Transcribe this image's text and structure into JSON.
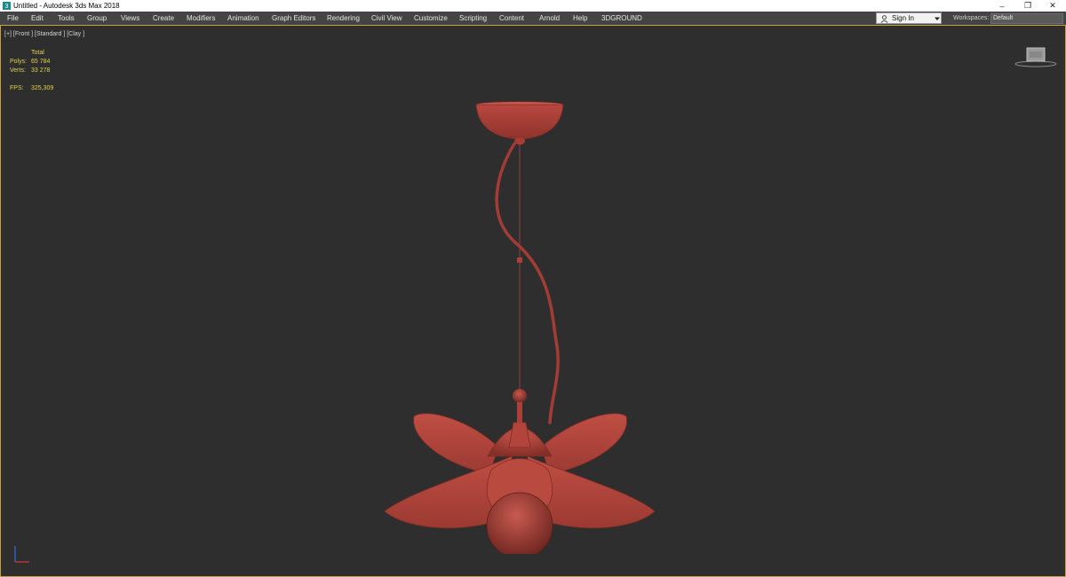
{
  "window": {
    "title": "Untitled - Autodesk 3ds Max 2018",
    "controls": {
      "minimize": "–",
      "restore": "❐",
      "close": "✕"
    }
  },
  "menubar": {
    "items": [
      "File",
      "Edit",
      "Tools",
      "Group",
      "Views",
      "Create",
      "Modifiers",
      "Animation",
      "Graph Editors",
      "Rendering",
      "Civil View",
      "Customize",
      "Scripting",
      "Content",
      "Arnold",
      "Help",
      "3DGROUND"
    ],
    "sign_in": "Sign In",
    "workspaces_label": "Workspaces:",
    "workspace_value": "Default"
  },
  "viewport": {
    "label": "[+] [Front ] [Standard ] [Clay ]",
    "stats": {
      "header": "Total",
      "polys_label": "Polys:",
      "polys_value": "65 784",
      "verts_label": "Verts:",
      "verts_value": "33 278",
      "fps_label": "FPS:",
      "fps_value": "325,309"
    }
  },
  "colors": {
    "menubar_bg": "#444444",
    "viewport_bg": "#2e2e2e",
    "viewport_border": "#c8a040",
    "stats_text": "#e0d24a",
    "clay": "#b54a41"
  }
}
